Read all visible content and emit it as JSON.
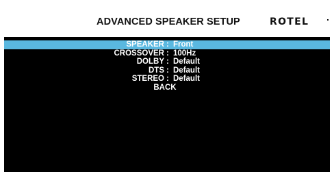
{
  "header": {
    "title": "ADVANCED SPEAKER SETUP",
    "logo": "ROTEL"
  },
  "menu": {
    "items": [
      {
        "label": "SPEAKER",
        "value": "Front",
        "selected": true
      },
      {
        "label": "CROSSOVER",
        "value": "100Hz",
        "selected": false
      },
      {
        "label": "DOLBY",
        "value": "Default",
        "selected": false
      },
      {
        "label": "DTS",
        "value": "Default",
        "selected": false
      },
      {
        "label": "STEREO",
        "value": "Default",
        "selected": false
      }
    ],
    "separator": ":",
    "back_label": "BACK"
  },
  "colors": {
    "background": "#000000",
    "header_background": "#ffffff",
    "highlight": "#5ab8e0",
    "text": "#ffffff"
  }
}
